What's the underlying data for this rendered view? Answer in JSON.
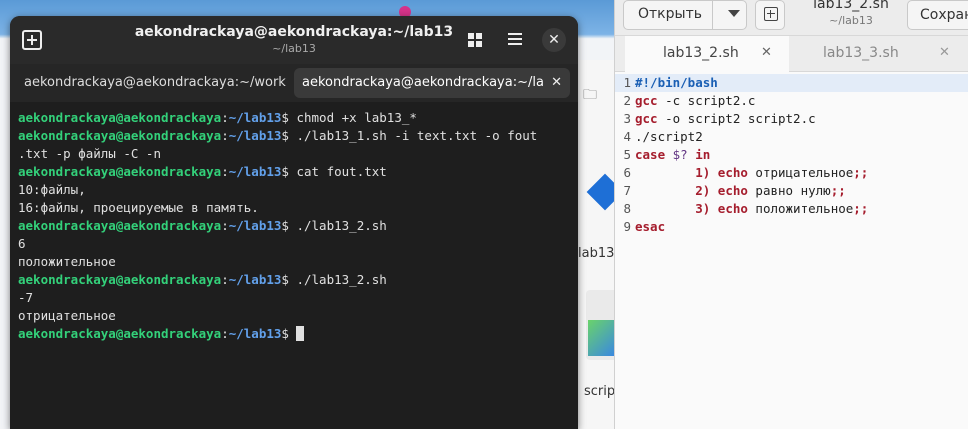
{
  "colors": {
    "terminal_bg": "#1e1e1e",
    "prompt_user": "#33d17a",
    "prompt_path": "#62a0ea",
    "editor_keyword": "#a51d2d",
    "editor_shebang": "#1a5fb4"
  },
  "file_manager": {
    "file1_label": "lab13_",
    "file2_label": "scrip"
  },
  "terminal": {
    "title": "aekondrackaya@aekondrackaya:~/lab13",
    "subtitle": "~/lab13",
    "tabs": [
      {
        "label": "aekondrackaya@aekondrackaya:~/work"
      },
      {
        "label": "aekondrackaya@aekondrackaya:~/la"
      }
    ],
    "prompt_user": "aekondrackaya@aekondrackaya",
    "prompt_sep": ":",
    "prompt_path": "~/lab13",
    "prompt_end": "$ ",
    "lines": {
      "l1_cmd": "chmod +x lab13_*",
      "l2_cmd": "./lab13_1.sh -i text.txt -o fout",
      "l3_out": ".txt -p файлы -C -n",
      "l4_cmd": "cat fout.txt",
      "l5_out": "10:файлы,",
      "l6_out": "16:файлы, проецируемые в память.",
      "l7_cmd": "./lab13_2.sh",
      "l8_out": "6",
      "l9_out": "положительное",
      "l10_cmd": "./lab13_2.sh",
      "l11_out": "-7",
      "l12_out": "отрицательное"
    }
  },
  "editor": {
    "open_label": "Открыть",
    "doc_title": "lab13_2.sh",
    "doc_path": "~/lab13",
    "save_label": "Сохран",
    "tabs": [
      {
        "label": "lab13_2.sh"
      },
      {
        "label": "lab13_3.sh"
      }
    ],
    "code": {
      "n1": "1",
      "n2": "2",
      "n3": "3",
      "n4": "4",
      "n5": "5",
      "n6": "6",
      "n7": "7",
      "n8": "8",
      "n9": "9",
      "shebang": "#!/bin/bash",
      "l2_kw": "gcc",
      "l2_rest": " -c script2.c",
      "l3_kw": "gcc",
      "l3_rest": " -o script2 script2.c",
      "l4": "./script2",
      "l5_kw": "case",
      "l5_var": " $?",
      "l5_in": " in",
      "l6_pat": "        1)",
      "l6_echo": " echo",
      "l6_txt": " отрицательное",
      "l6_end": ";;",
      "l7_pat": "        2)",
      "l7_echo": " echo",
      "l7_txt": " равно нулю",
      "l7_end": ";;",
      "l8_pat": "        3)",
      "l8_echo": " echo",
      "l8_txt": " положительное",
      "l8_end": ";;",
      "l9": "esac"
    }
  }
}
